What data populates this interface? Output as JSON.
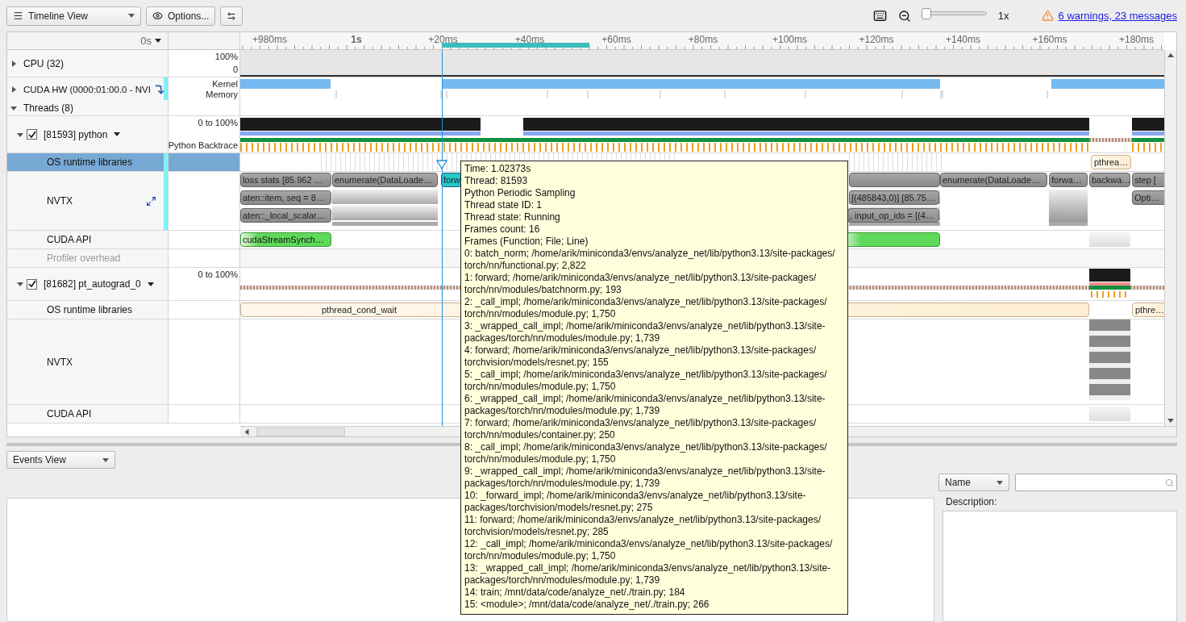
{
  "toolbar": {
    "view_selector": "Timeline View",
    "options_button": "Options...",
    "zoom": {
      "level": 0
    },
    "zoom_reading": "1x",
    "warnings_link": "6 warnings, 23 messages"
  },
  "timeline": {
    "time_origin": "0s",
    "ruler_ticks": [
      {
        "label": "+980ms",
        "major": false
      },
      {
        "label": "1s",
        "major": true
      },
      {
        "label": "+20ms",
        "major": false
      },
      {
        "label": "+40ms",
        "major": false
      },
      {
        "label": "+60ms",
        "major": false
      },
      {
        "label": "+80ms",
        "major": false
      },
      {
        "label": "+100ms",
        "major": false
      },
      {
        "label": "+120ms",
        "major": false
      },
      {
        "label": "+140ms",
        "major": false
      },
      {
        "label": "+160ms",
        "major": false
      },
      {
        "label": "+180ms",
        "major": false
      }
    ],
    "rows": [
      {
        "kind": "cpu",
        "label": "CPU (32)",
        "expanded": false,
        "selected": false,
        "meta": [
          "100%",
          "0"
        ]
      },
      {
        "kind": "gpu",
        "label": "CUDA HW (0000:01:00.0 - NVI",
        "expanded": false,
        "selected": false,
        "meta": [
          "Kernel",
          "Memory"
        ]
      },
      {
        "kind": "group",
        "label": "Threads (8)",
        "expanded": true,
        "selected": false
      },
      {
        "kind": "thread",
        "label": "[81593] python",
        "expanded": true,
        "checked": true,
        "selected": false,
        "meta": [
          "0 to 100%",
          "Python Backtrace"
        ]
      },
      {
        "kind": "osrt",
        "label": "OS runtime libraries",
        "selected": true,
        "blocks": [
          {
            "label": "pthrea…"
          }
        ]
      },
      {
        "kind": "nvtx",
        "label": "NVTX",
        "selected": false,
        "lanes": [
          [
            {
              "label": "loss stats [85.962 …",
              "selected": false
            },
            {
              "label": "enumerate(DataLoade…",
              "selected": false
            },
            {
              "label": "forw",
              "selected": true
            },
            {
              "label": "enumerate(DataLoade…",
              "selected": false
            },
            {
              "label": "forwa…",
              "selected": false
            },
            {
              "label": "backwa…",
              "selected": false
            },
            {
              "label": "step [",
              "selected": false
            }
          ],
          [
            {
              "label": "aten::item, seq = 8…",
              "selected": false
            },
            {
              "label": "[(485843,0)] [85.75…",
              "selected": false
            },
            {
              "label": "Opti…",
              "selected": false
            }
          ],
          [
            {
              "label": "aten::_local_scalar…",
              "selected": false
            },
            {
              "label": ", input_op_ids = [(4…",
              "selected": false
            }
          ]
        ]
      },
      {
        "kind": "cudaapi",
        "label": "CUDA API",
        "selected": false,
        "blocks": [
          {
            "label": "cudaStreamSynch…"
          }
        ]
      },
      {
        "kind": "overhead",
        "label": "Profiler overhead",
        "selected": false,
        "disabled": true
      },
      {
        "kind": "thread",
        "label": "[81682] pt_autograd_0",
        "expanded": true,
        "checked": true,
        "selected": false,
        "meta": [
          "0 to 100%"
        ]
      },
      {
        "kind": "osrt",
        "label": "OS runtime libraries",
        "selected": false,
        "blocks": [
          {
            "label": "pthread_cond_wait"
          },
          {
            "label": "pthre…"
          }
        ]
      },
      {
        "kind": "nvtx",
        "label": "NVTX",
        "selected": false,
        "lanes": []
      },
      {
        "kind": "cudaapi",
        "label": "CUDA API",
        "selected": false,
        "blocks": []
      }
    ]
  },
  "tooltip": {
    "lines": [
      "Time: 1.02373s",
      "Thread: 81593",
      "Python Periodic Sampling",
      "Thread state ID: 1",
      "Thread state: Running",
      "Frames count: 16",
      "Frames (Function; File; Line)"
    ],
    "frames": [
      [
        "0: batch_norm; /home/arik/miniconda3/envs/analyze_net/lib/python3.13/site-packages/",
        "torch/nn/functional.py; 2,822"
      ],
      [
        "1: forward; /home/arik/miniconda3/envs/analyze_net/lib/python3.13/site-packages/",
        "torch/nn/modules/batchnorm.py; 193"
      ],
      [
        "2: _call_impl; /home/arik/miniconda3/envs/analyze_net/lib/python3.13/site-packages/",
        "torch/nn/modules/module.py; 1,750"
      ],
      [
        "3: _wrapped_call_impl; /home/arik/miniconda3/envs/analyze_net/lib/python3.13/site-",
        "packages/torch/nn/modules/module.py; 1,739"
      ],
      [
        "4: forward; /home/arik/miniconda3/envs/analyze_net/lib/python3.13/site-packages/",
        "torchvision/models/resnet.py; 155"
      ],
      [
        "5: _call_impl; /home/arik/miniconda3/envs/analyze_net/lib/python3.13/site-packages/",
        "torch/nn/modules/module.py; 1,750"
      ],
      [
        "6: _wrapped_call_impl; /home/arik/miniconda3/envs/analyze_net/lib/python3.13/site-",
        "packages/torch/nn/modules/module.py; 1,739"
      ],
      [
        "7: forward; /home/arik/miniconda3/envs/analyze_net/lib/python3.13/site-packages/",
        "torch/nn/modules/container.py; 250"
      ],
      [
        "8: _call_impl; /home/arik/miniconda3/envs/analyze_net/lib/python3.13/site-packages/",
        "torch/nn/modules/module.py; 1,750"
      ],
      [
        "9: _wrapped_call_impl; /home/arik/miniconda3/envs/analyze_net/lib/python3.13/site-",
        "packages/torch/nn/modules/module.py; 1,739"
      ],
      [
        "10: _forward_impl; /home/arik/miniconda3/envs/analyze_net/lib/python3.13/site-",
        "packages/torchvision/models/resnet.py; 275"
      ],
      [
        "11: forward; /home/arik/miniconda3/envs/analyze_net/lib/python3.13/site-packages/",
        "torchvision/models/resnet.py; 285"
      ],
      [
        "12: _call_impl; /home/arik/miniconda3/envs/analyze_net/lib/python3.13/site-packages/",
        "torch/nn/modules/module.py; 1,750"
      ],
      [
        "13: _wrapped_call_impl; /home/arik/miniconda3/envs/analyze_net/lib/python3.13/site-",
        "packages/torch/nn/modules/module.py; 1,739"
      ],
      [
        "14: train; /mnt/data/code/analyze_net/./train.py; 184"
      ],
      [
        "15: <module>; /mnt/data/code/analyze_net/./train.py; 266"
      ]
    ]
  },
  "events": {
    "view_selector": "Events View",
    "column_selector": "Name",
    "description_label": "Description:"
  }
}
